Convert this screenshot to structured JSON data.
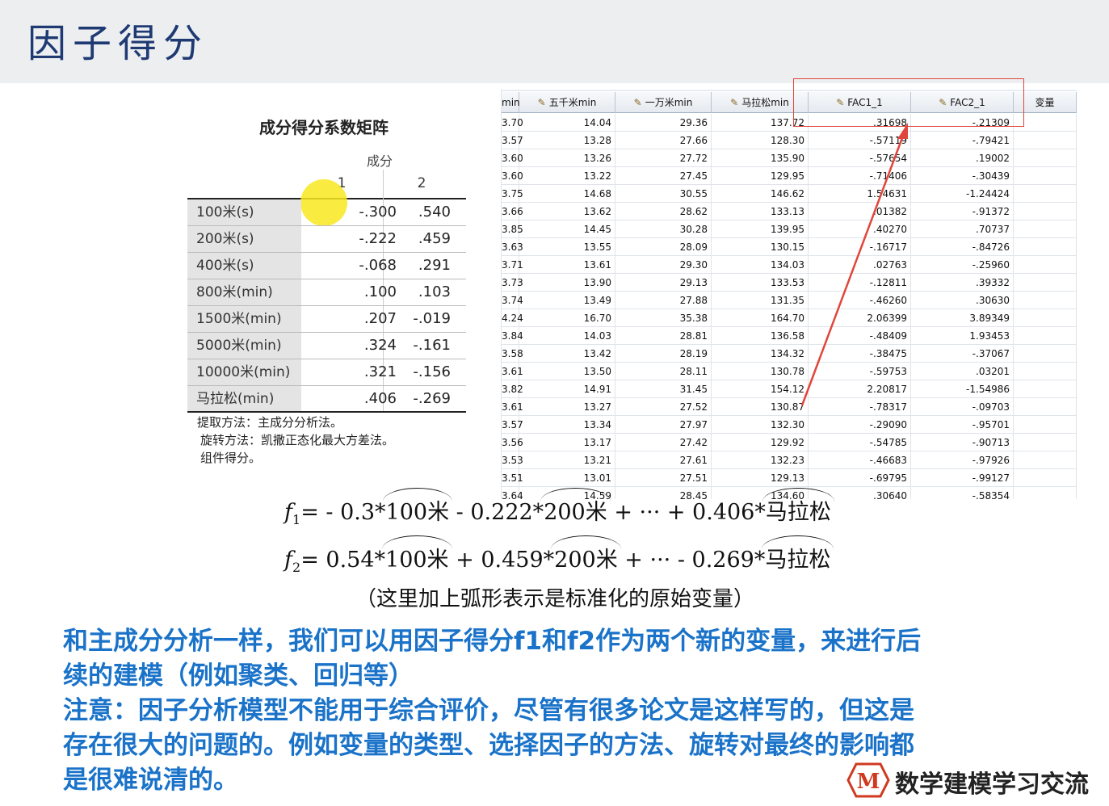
{
  "page": {
    "title": "因子得分"
  },
  "matrix": {
    "title": "成分得分系数矩阵",
    "component_label": "成分",
    "col_headers": [
      "1",
      "2"
    ],
    "rows": [
      {
        "label": "100米(s)",
        "c1": "-.300",
        "c2": ".540"
      },
      {
        "label": "200米(s)",
        "c1": "-.222",
        "c2": ".459"
      },
      {
        "label": "400米(s)",
        "c1": "-.068",
        "c2": ".291"
      },
      {
        "label": "800米(min)",
        "c1": ".100",
        "c2": ".103"
      },
      {
        "label": "1500米(min)",
        "c1": ".207",
        "c2": "-.019"
      },
      {
        "label": "5000米(min)",
        "c1": ".324",
        "c2": "-.161"
      },
      {
        "label": "10000米(min)",
        "c1": ".321",
        "c2": "-.156"
      },
      {
        "label": "马拉松(min)",
        "c1": ".406",
        "c2": "-.269"
      }
    ],
    "notes": [
      "提取方法：主成分分析法。",
      "旋转方法：凯撒正态化最大方差法。",
      "组件得分。"
    ]
  },
  "sheet": {
    "columns": [
      "min",
      "五千米min",
      "一万米min",
      "马拉松min",
      "FAC1_1",
      "FAC2_1",
      "变量"
    ],
    "rows": [
      [
        "3.70",
        "14.04",
        "29.36",
        "137.72",
        ".31698",
        "-.21309"
      ],
      [
        "3.57",
        "13.28",
        "27.66",
        "128.30",
        "-.57119",
        "-.79421"
      ],
      [
        "3.60",
        "13.26",
        "27.72",
        "135.90",
        "-.57654",
        ".19002"
      ],
      [
        "3.60",
        "13.22",
        "27.45",
        "129.95",
        "-.71406",
        "-.30439"
      ],
      [
        "3.75",
        "14.68",
        "30.55",
        "146.62",
        "1.54631",
        "-1.24424"
      ],
      [
        "3.66",
        "13.62",
        "28.62",
        "133.13",
        ".01382",
        "-.91372"
      ],
      [
        "3.85",
        "14.45",
        "30.28",
        "139.95",
        ".40270",
        ".70737"
      ],
      [
        "3.63",
        "13.55",
        "28.09",
        "130.15",
        "-.16717",
        "-.84726"
      ],
      [
        "3.71",
        "13.61",
        "29.30",
        "134.03",
        ".02763",
        "-.25960"
      ],
      [
        "3.73",
        "13.90",
        "29.13",
        "133.53",
        "-.12811",
        ".39332"
      ],
      [
        "3.74",
        "13.49",
        "27.88",
        "131.35",
        "-.46260",
        ".30630"
      ],
      [
        "4.24",
        "16.70",
        "35.38",
        "164.70",
        "2.06399",
        "3.89349"
      ],
      [
        "3.84",
        "14.03",
        "28.81",
        "136.58",
        "-.48409",
        "1.93453"
      ],
      [
        "3.58",
        "13.42",
        "28.19",
        "134.32",
        "-.38475",
        "-.37067"
      ],
      [
        "3.61",
        "13.50",
        "28.11",
        "130.78",
        "-.59753",
        ".03201"
      ],
      [
        "3.82",
        "14.91",
        "31.45",
        "154.12",
        "2.20817",
        "-1.54986"
      ],
      [
        "3.61",
        "13.27",
        "27.52",
        "130.87",
        "-.78317",
        "-.09703"
      ],
      [
        "3.57",
        "13.34",
        "27.97",
        "132.30",
        "-.29090",
        "-.95701"
      ],
      [
        "3.56",
        "13.17",
        "27.42",
        "129.92",
        "-.54785",
        "-.90713"
      ],
      [
        "3.53",
        "13.21",
        "27.61",
        "132.23",
        "-.46683",
        "-.97926"
      ],
      [
        "3.51",
        "13.01",
        "27.51",
        "129.13",
        "-.69795",
        "-.99127"
      ],
      [
        "3.64",
        "14.59",
        "28.45",
        "134.60",
        ".30640",
        "-.58354"
      ]
    ]
  },
  "formula1": {
    "lhs": "f",
    "sub": "1",
    "parts": [
      "= - 0.3*",
      "100米",
      " - 0.222*",
      "200米",
      " + ··· + 0.406*",
      "马拉松"
    ]
  },
  "formula2": {
    "lhs": "f",
    "sub": "2",
    "parts": [
      "= 0.54*",
      "100米",
      " + 0.459*",
      "200米",
      " + ··· - 0.269*",
      "马拉松"
    ]
  },
  "remark": "（这里加上弧形表示是标准化的原始变量）",
  "notes": [
    "和主成分分析一样，我们可以用因子得分f1和f2作为两个新的变量，来进行后",
    "续的建模（例如聚类、回归等）",
    "注意：因子分析模型不能用于综合评价，尽管有很多论文是这样写的，但这是",
    "存在很大的问题的。例如变量的类型、选择因子的方法、旋转对最终的影响都",
    "是很难说清的。"
  ],
  "logo": {
    "letter": "M",
    "text": "数学建模学习交流"
  },
  "colors": {
    "note_blue": "#1a73c9",
    "title_blue": "#1f3a73",
    "highlight_red": "#e0463c",
    "header_bg": "#eceef0"
  }
}
